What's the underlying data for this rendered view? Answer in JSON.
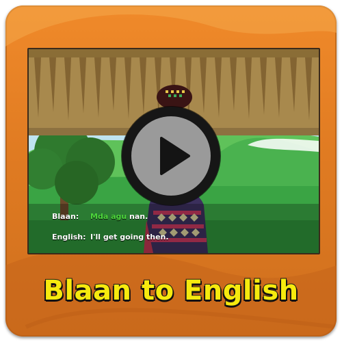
{
  "video": {
    "subtitles": {
      "blaan_label": "Blaan:",
      "blaan_highlight": "Mda agu",
      "blaan_rest": " nan.",
      "english_label": "English:",
      "english_text": "I'll get going then."
    },
    "play_icon": "play-icon"
  },
  "title": "Blaan to English",
  "colors": {
    "tile_orange": "#e07b22",
    "title_yellow": "#f6ea0e",
    "subtitle_highlight": "#4cd63b",
    "play_button_gray": "#9a9a9a"
  }
}
